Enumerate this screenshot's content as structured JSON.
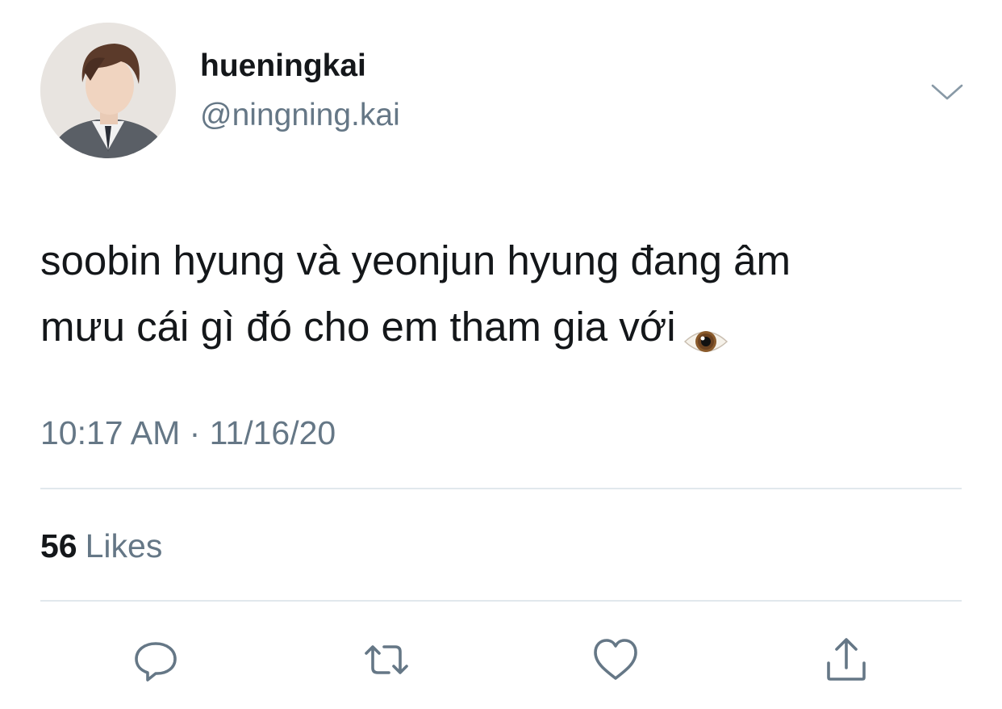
{
  "tweet": {
    "display_name": "hueningkai",
    "handle": "@ningning.kai",
    "text_line1": "soobin hyung và yeonjun hyung đang âm",
    "text_line2": "mưu cái gì đó cho em tham gia với",
    "emoji": "eye-emoji",
    "timestamp": "10:17 AM · 11/16/20",
    "likes_count": "56",
    "likes_label": "Likes"
  },
  "icons": {
    "menu": "chevron-down-icon",
    "reply": "reply-icon",
    "retweet": "retweet-icon",
    "like": "heart-icon",
    "share": "share-icon"
  },
  "colors": {
    "text_primary": "#14171a",
    "text_secondary": "#657786",
    "divider": "#e1e8ed",
    "icon": "#657786"
  }
}
